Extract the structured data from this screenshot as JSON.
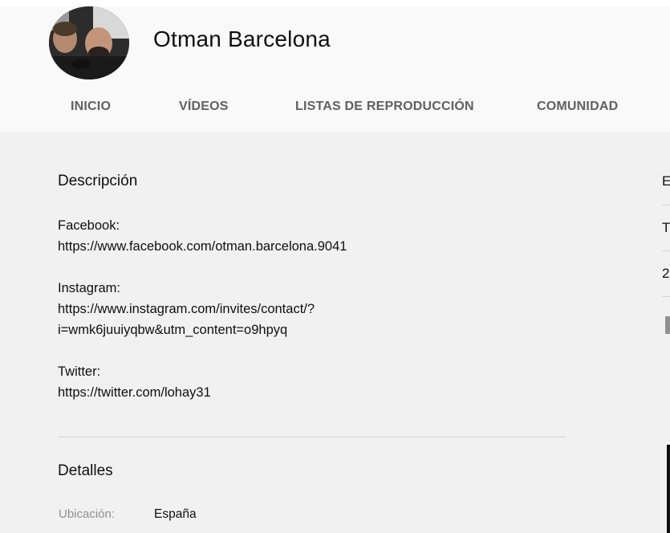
{
  "channel": {
    "name": "Otman Barcelona"
  },
  "tabs": [
    {
      "label": "INICIO"
    },
    {
      "label": "VÍDEOS"
    },
    {
      "label": "LISTAS DE REPRODUCCIÓN"
    },
    {
      "label": "COMUNIDAD"
    }
  ],
  "description": {
    "title": "Descripción",
    "facebook_label": "Facebook:",
    "facebook_url": "https://www.facebook.com/otman.barcelona.9041",
    "instagram_label": "Instagram:",
    "instagram_url_line1": "https://www.instagram.com/invites/contact/?",
    "instagram_url_line2": "i=wmk6juuiyqbw&utm_content=o9hpyq",
    "twitter_label": "Twitter:",
    "twitter_url": "https://twitter.com/lohay31"
  },
  "details": {
    "title": "Detalles",
    "location_label": "Ubicación:",
    "location_value": "España"
  },
  "sidebar_partial": {
    "line1": "E",
    "line2": "T",
    "line3": "2"
  },
  "icons": {
    "flag": "flag-icon"
  }
}
